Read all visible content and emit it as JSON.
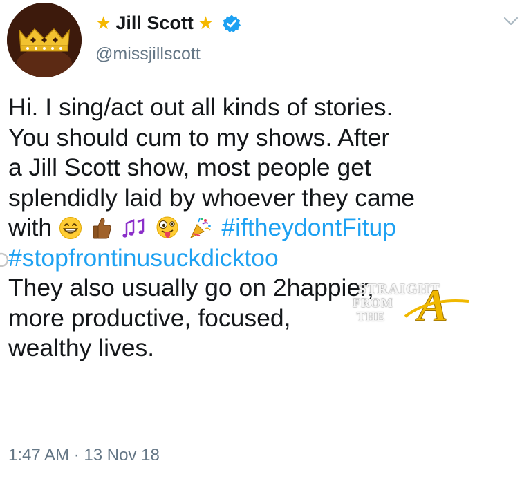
{
  "author": {
    "star_left": "★",
    "display_name": "Jill Scott",
    "star_right": "★",
    "handle": "@missjillscott",
    "verified_icon": "verified-badge-icon",
    "avatar_icon": "crown-avatar"
  },
  "menu": {
    "icon": "chevron-down-icon"
  },
  "tweet": {
    "line1": "Hi. I sing/act out all kinds of stories.",
    "line2": "You should cum to my shows. After",
    "line3": "a Jill Scott show, most people get",
    "line4": "splendidly laid by whoever they came",
    "line5_text": "with",
    "line5_emojis": [
      "grinning-face",
      "thumbs-up",
      "musical-notes",
      "zany-face",
      "party-popper"
    ],
    "hashtag1": "#iftheydontFitup",
    "hashtag2": "#stopfrontinusuckdicktoo",
    "line7": "They also usually go on 2happier,",
    "line8": "more productive, focused,",
    "line9": "wealthy lives."
  },
  "timestamp": "1:47 AM · 13 Nov 18",
  "watermark": {
    "line1": "STRAIGHT",
    "line2": "FROM",
    "line3": "THE",
    "letter": "A"
  },
  "colors": {
    "text": "#14171a",
    "secondary": "#657786",
    "link": "#1da1f2",
    "star": "#f5b800",
    "verified": "#1da1f2"
  }
}
